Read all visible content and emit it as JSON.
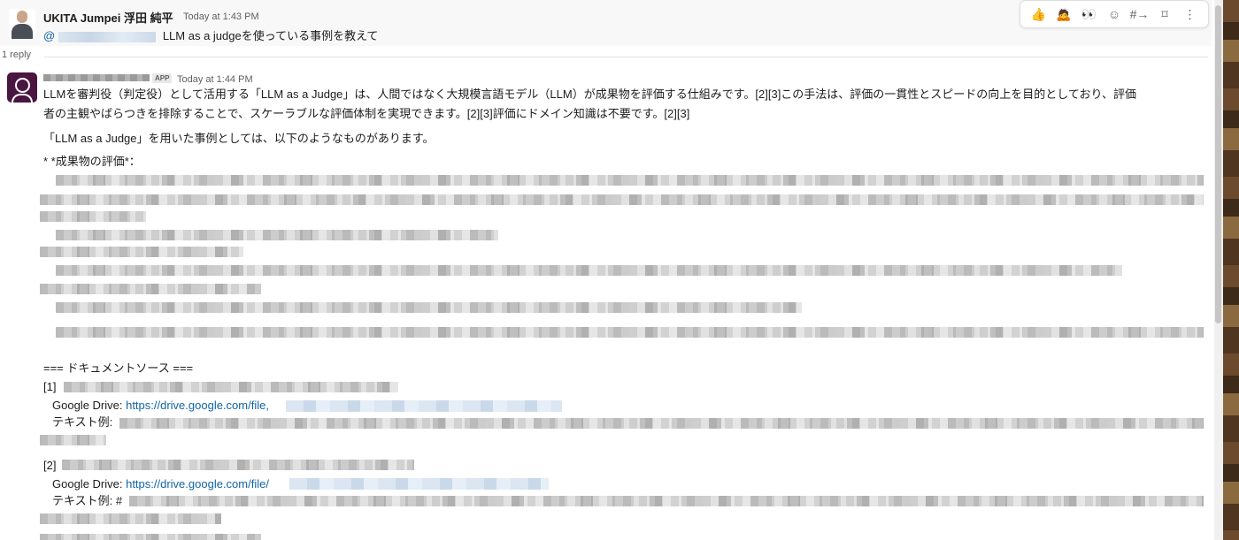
{
  "parent_message": {
    "sender": "UKITA Jumpei 浮田 純平",
    "timestamp": "Today at 1:43 PM",
    "mention_prefix": "@",
    "text": "LLM as a judgeを使っている事例を教えて"
  },
  "toolbar": {
    "items": [
      "👍",
      "🙇",
      "👀",
      "☺",
      "#→",
      "⌑",
      "⋮"
    ],
    "icons": [
      "thumbs-up-icon",
      "bow-icon",
      "eyes-icon",
      "add-reaction-icon",
      "forward-icon",
      "bookmark-icon",
      "more-icon"
    ]
  },
  "thread": {
    "reply_count": "1 reply"
  },
  "bot_message": {
    "badge": "APP",
    "timestamp": "Today at 1:44 PM",
    "paragraph1_line1": "LLMを審判役（判定役）として活用する「LLM as a Judge」は、人間ではなく大規模言語モデル（LLM）が成果物を評価する仕組みです。[2][3]この手法は、評価の一貫性とスピードの向上を目的としており、評価",
    "paragraph1_line2": "者の主観やばらつきを排除することで、スケーラブルな評価体制を実現できます。[2][3]評価にドメイン知識は不要です。[2][3]",
    "paragraph2": "「LLM as a Judge」を用いた事例としては、以下のようなものがあります。",
    "bullet": "*   *成果物の評価*：",
    "sources_header": "=== ドキュメントソース ===",
    "source1": {
      "num": "[1]",
      "drive_label": "Google Drive: ",
      "drive_link": "https://drive.google.com/file,",
      "text_label": "テキスト例: "
    },
    "source2": {
      "num": "[2]",
      "drive_label": "Google Drive: ",
      "drive_link": "https://drive.google.com/file/",
      "text_label": "テキスト例: #"
    }
  }
}
